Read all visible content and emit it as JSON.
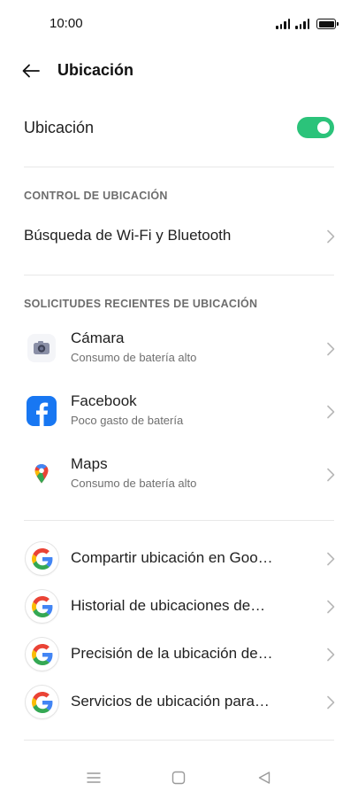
{
  "status_bar": {
    "time": "10:00"
  },
  "app_bar": {
    "title": "Ubicación"
  },
  "main_toggle": {
    "label": "Ubicación",
    "enabled": true,
    "accent_color": "#2bc37a"
  },
  "control_section": {
    "header": "CONTROL DE UBICACIÓN",
    "items": [
      {
        "label": "Búsqueda de Wi-Fi y Bluetooth"
      }
    ]
  },
  "recent_section": {
    "header": "SOLICITUDES RECIENTES DE UBICACIÓN",
    "apps": [
      {
        "name": "Cámara",
        "detail": "Consumo de batería alto",
        "icon": "camera-icon"
      },
      {
        "name": "Facebook",
        "detail": "Poco gasto de batería",
        "icon": "facebook-icon"
      },
      {
        "name": "Maps",
        "detail": "Consumo de batería alto",
        "icon": "maps-icon"
      }
    ]
  },
  "google_section": {
    "items": [
      {
        "label": "Compartir ubicación en Goo…",
        "icon": "google-icon"
      },
      {
        "label": "Historial de ubicaciones de…",
        "icon": "google-icon"
      },
      {
        "label": "Precisión de la ubicación de…",
        "icon": "google-icon"
      },
      {
        "label": "Servicios de ubicación para…",
        "icon": "google-icon"
      }
    ]
  },
  "nav_bar": {
    "icons": [
      "menu-icon",
      "home-icon",
      "back-triangle-icon"
    ]
  }
}
